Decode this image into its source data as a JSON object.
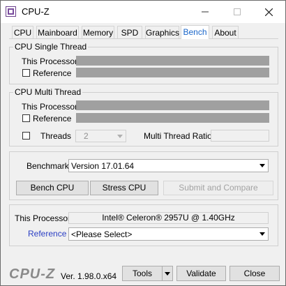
{
  "window": {
    "title": "CPU-Z",
    "minimize_icon": "minimize-icon",
    "maximize_icon": "maximize-icon",
    "close_icon": "close-icon"
  },
  "tabs": [
    {
      "label": "CPU"
    },
    {
      "label": "Mainboard"
    },
    {
      "label": "Memory"
    },
    {
      "label": "SPD"
    },
    {
      "label": "Graphics"
    },
    {
      "label": "Bench",
      "active": true
    },
    {
      "label": "About"
    }
  ],
  "single_thread": {
    "title": "CPU Single Thread",
    "this_processor": "This Processor",
    "reference": "Reference"
  },
  "multi_thread": {
    "title": "CPU Multi Thread",
    "this_processor": "This Processor",
    "reference": "Reference",
    "threads_label": "Threads",
    "threads_value": "2",
    "ratio_label": "Multi Thread Ratio"
  },
  "benchmark": {
    "label": "Benchmark",
    "version": "Version 17.01.64",
    "bench_cpu": "Bench CPU",
    "stress_cpu": "Stress CPU",
    "submit": "Submit and Compare"
  },
  "processor": {
    "this_processor_label": "This Processor",
    "this_processor_value": "Intel® Celeron® 2957U @ 1.40GHz",
    "reference_label": "Reference",
    "reference_value": "<Please Select>"
  },
  "footer": {
    "logo": "CPU-Z",
    "version": "Ver. 1.98.0.x64",
    "tools": "Tools",
    "validate": "Validate",
    "close": "Close"
  },
  "colors": {
    "accent": "#1a66c9",
    "bar": "#a0a0a0",
    "reference_link": "#2b3fc4"
  }
}
